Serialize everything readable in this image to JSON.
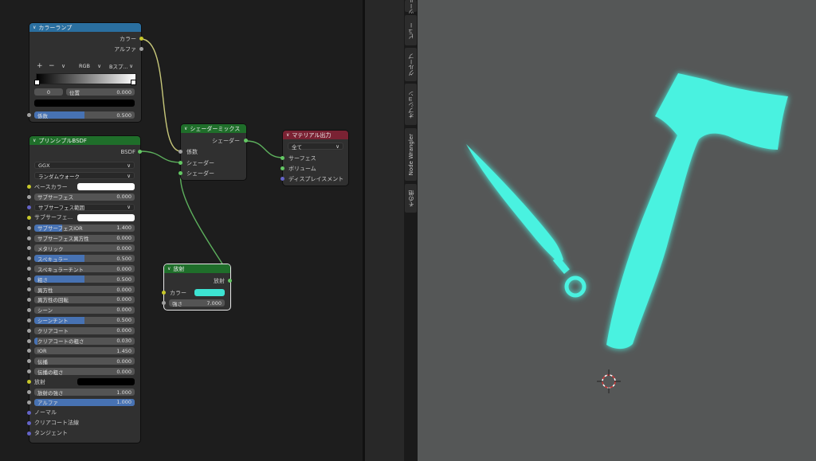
{
  "sidebar_tabs": [
    "ツール",
    "ビュー",
    "グループ",
    "オプション",
    "Node Wrangler",
    "その他"
  ],
  "colorramp": {
    "title": "カラーランプ",
    "out_color": "カラー",
    "out_alpha": "アルファ",
    "plus": "+",
    "minus": "−",
    "chevron": "∨",
    "mode": "RGB",
    "interp": "Bスプ...",
    "stop_index": "0",
    "pos_label": "位置",
    "pos_value": "0.000",
    "fac_label": "係数",
    "fac_value": "0.500",
    "fac_fraction": 0.5,
    "stop_color": "#000000"
  },
  "bsdf": {
    "title": "プリンシプルBSDF",
    "out": "BSDF",
    "distribution": "GGX",
    "sss_method": "ランダムウォーク",
    "rows": [
      {
        "label": "ベースカラー",
        "type": "color",
        "color": "#ffffff",
        "socket": "sc"
      },
      {
        "label": "サブサーフェス",
        "value": "0.000",
        "fill": 0,
        "socket": "sf"
      },
      {
        "label": "サブサーフェス範囲",
        "type": "dropdown",
        "socket": "sv"
      },
      {
        "label": "サブサーフェ...",
        "type": "color",
        "color": "#ffffff",
        "socket": "sc"
      },
      {
        "label": "サブサーフェスIOR",
        "value": "1.400",
        "fill": 0.28,
        "socket": "sf"
      },
      {
        "label": "サブサーフェス異方性",
        "value": "0.000",
        "fill": 0,
        "socket": "sf"
      },
      {
        "label": "メタリック",
        "value": "0.000",
        "fill": 0,
        "socket": "sf"
      },
      {
        "label": "スペキュラー",
        "value": "0.500",
        "fill": 0.5,
        "socket": "sf"
      },
      {
        "label": "スペキュラーチント",
        "value": "0.000",
        "fill": 0,
        "socket": "sf"
      },
      {
        "label": "粗さ",
        "value": "0.500",
        "fill": 0.5,
        "socket": "sf"
      },
      {
        "label": "異方性",
        "value": "0.000",
        "fill": 0,
        "socket": "sf"
      },
      {
        "label": "異方性の回転",
        "value": "0.000",
        "fill": 0,
        "socket": "sf"
      },
      {
        "label": "シーン",
        "value": "0.000",
        "fill": 0,
        "socket": "sf"
      },
      {
        "label": "シーンチント",
        "value": "0.500",
        "fill": 0.5,
        "socket": "sf"
      },
      {
        "label": "クリアコート",
        "value": "0.000",
        "fill": 0,
        "socket": "sf"
      },
      {
        "label": "クリアコートの粗さ",
        "value": "0.030",
        "fill": 0.03,
        "socket": "sf"
      },
      {
        "label": "IOR",
        "value": "1.450",
        "fill": 0,
        "socket": "sf"
      },
      {
        "label": "伝播",
        "value": "0.000",
        "fill": 0,
        "socket": "sf"
      },
      {
        "label": "伝播の粗さ",
        "value": "0.000",
        "fill": 0,
        "socket": "sf"
      },
      {
        "label": "放射",
        "type": "color",
        "color": "#000000",
        "socket": "sc"
      },
      {
        "label": "放射の強さ",
        "value": "1.000",
        "fill": 0,
        "socket": "sf"
      },
      {
        "label": "アルファ",
        "value": "1.000",
        "fill": 1,
        "socket": "sf"
      },
      {
        "label": "ノーマル",
        "type": "socket",
        "socket": "sv"
      },
      {
        "label": "クリアコート法線",
        "type": "socket",
        "socket": "sv"
      },
      {
        "label": "タンジェント",
        "type": "socket",
        "socket": "sv"
      }
    ]
  },
  "mix": {
    "title": "シェーダーミックス",
    "out": "シェーダー",
    "in_fac": "係数",
    "in_shader1": "シェーダー",
    "in_shader2": "シェーダー"
  },
  "output": {
    "title": "マテリアル出力",
    "target": "全て",
    "surface": "サーフェス",
    "volume": "ボリューム",
    "displacement": "ディスプレイスメント"
  },
  "emission": {
    "title": "放射",
    "out": "放射",
    "color_label": "カラー",
    "color": "#3de3d2",
    "strength_label": "強さ",
    "strength_value": "7.000"
  },
  "colors": {
    "shader_header": "#1f6e2a",
    "converter_header": "#2a6fa0",
    "output_header": "#7a2233",
    "emissive": "#49f2e0",
    "viewport_bg": "#555757"
  }
}
